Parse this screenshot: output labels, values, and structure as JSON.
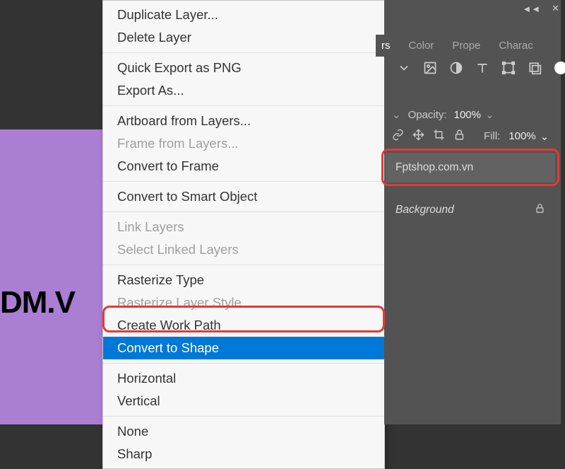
{
  "canvas": {
    "text": "DM.V"
  },
  "ctx_menu": {
    "items": [
      {
        "label": "Duplicate Layer...",
        "disabled": false
      },
      {
        "label": "Delete Layer",
        "disabled": false
      },
      {
        "sep": true
      },
      {
        "label": "Quick Export as PNG",
        "disabled": false
      },
      {
        "label": "Export As...",
        "disabled": false
      },
      {
        "sep": true
      },
      {
        "label": "Artboard from Layers...",
        "disabled": false
      },
      {
        "label": "Frame from Layers...",
        "disabled": true
      },
      {
        "label": "Convert to Frame",
        "disabled": false
      },
      {
        "sep": true
      },
      {
        "label": "Convert to Smart Object",
        "disabled": false
      },
      {
        "sep": true
      },
      {
        "label": "Link Layers",
        "disabled": true
      },
      {
        "label": "Select Linked Layers",
        "disabled": true
      },
      {
        "sep": true
      },
      {
        "label": "Rasterize Type",
        "disabled": false
      },
      {
        "label": "Rasterize Layer Style",
        "disabled": true
      },
      {
        "label": "Create Work Path",
        "disabled": false
      },
      {
        "label": "Convert to Shape",
        "disabled": false,
        "highlighted": true
      },
      {
        "sep": true
      },
      {
        "label": "Horizontal",
        "disabled": false
      },
      {
        "label": "Vertical",
        "disabled": false
      },
      {
        "sep": true
      },
      {
        "label": "None",
        "disabled": false
      },
      {
        "label": "Sharp",
        "disabled": false
      }
    ]
  },
  "tabs": {
    "layers": "rs",
    "color": "Color",
    "properties": "Prope",
    "character": "Charac"
  },
  "opacity": {
    "label": "Opacity:",
    "value": "100%"
  },
  "fill": {
    "label": "Fill:",
    "value": "100%"
  },
  "layers": {
    "selected": "Fptshop.com.vn",
    "background": "Background"
  },
  "window": {
    "collapse": "◄◄",
    "close": "✕"
  }
}
